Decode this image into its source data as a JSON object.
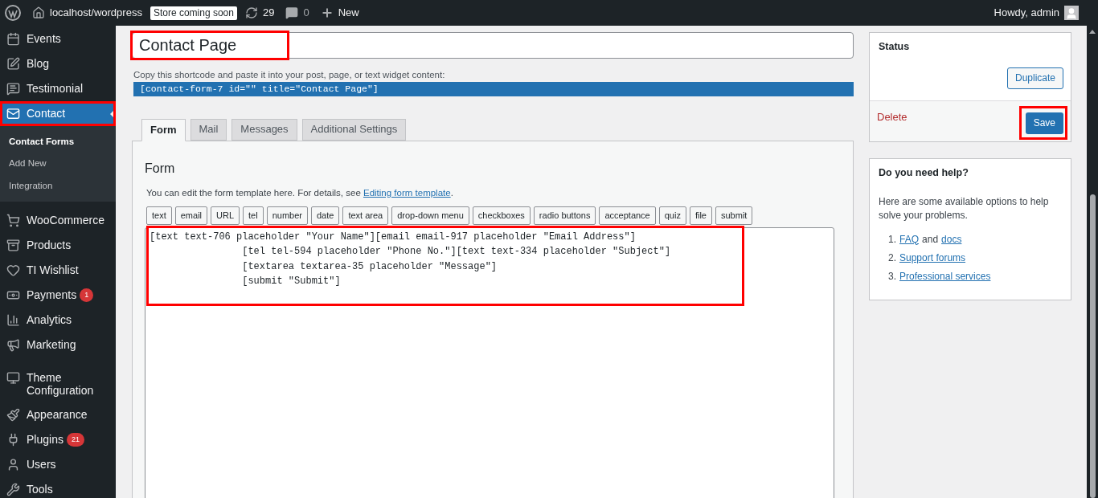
{
  "admin_bar": {
    "site": "localhost/wordpress",
    "store_badge": "Store coming soon",
    "updates": "29",
    "comments": "0",
    "new": "New",
    "greeting": "Howdy, admin"
  },
  "sidebar": {
    "items": [
      {
        "label": "Events",
        "selected": false,
        "highlighted": false
      },
      {
        "label": "Blog",
        "selected": false,
        "highlighted": false
      },
      {
        "label": "Testimonial",
        "selected": false,
        "highlighted": false
      },
      {
        "label": "Contact",
        "selected": true,
        "highlighted": true,
        "children": [
          {
            "label": "Contact Forms",
            "selected": true
          },
          {
            "label": "Add New",
            "selected": false
          },
          {
            "label": "Integration",
            "selected": false
          }
        ]
      },
      {
        "label": "WooCommerce",
        "selected": false,
        "highlighted": false
      },
      {
        "label": "Products",
        "selected": false,
        "highlighted": false
      },
      {
        "label": "TI Wishlist",
        "selected": false,
        "highlighted": false
      },
      {
        "label": "Payments",
        "selected": false,
        "highlighted": false,
        "badge": "1"
      },
      {
        "label": "Analytics",
        "selected": false,
        "highlighted": false
      },
      {
        "label": "Marketing",
        "selected": false,
        "highlighted": false
      },
      {
        "label": "Theme Configuration",
        "selected": false,
        "highlighted": false
      },
      {
        "label": "Appearance",
        "selected": false,
        "highlighted": false
      },
      {
        "label": "Plugins",
        "selected": false,
        "highlighted": false,
        "badge": "21"
      },
      {
        "label": "Users",
        "selected": false,
        "highlighted": false
      },
      {
        "label": "Tools",
        "selected": false,
        "highlighted": false
      }
    ]
  },
  "title_field": {
    "value": "Contact Page",
    "highlighted": true
  },
  "shortcode": {
    "hint": "Copy this shortcode and paste it into your post, page, or text widget content:",
    "code": "[contact-form-7 id=\"\" title=\"Contact Page\"]"
  },
  "tabs": [
    {
      "label": "Form",
      "selected": true
    },
    {
      "label": "Mail",
      "selected": false
    },
    {
      "label": "Messages",
      "selected": false
    },
    {
      "label": "Additional Settings",
      "selected": false
    }
  ],
  "form_panel": {
    "heading": "Form",
    "description_before": "You can edit the form template here. For details, see ",
    "link": "Editing form template",
    "description_after": ".",
    "tag_buttons": [
      "text",
      "email",
      "URL",
      "tel",
      "number",
      "date",
      "text area",
      "drop-down menu",
      "checkboxes",
      "radio buttons",
      "acceptance",
      "quiz",
      "file",
      "submit"
    ],
    "template": {
      "highlighted": true,
      "lines": [
        "[text text-706 placeholder \"Your Name\"][email email-917 placeholder \"Email Address\"]",
        "                [tel tel-594 placeholder \"Phone No.\"][text text-334 placeholder \"Subject\"]",
        "                [textarea textarea-35 placeholder \"Message\"]",
        "                [submit \"Submit\"]"
      ]
    }
  },
  "status_box": {
    "title": "Status",
    "duplicate": "Duplicate",
    "delete": "Delete",
    "save": "Save",
    "save_highlighted": true
  },
  "help_box": {
    "title": "Do you need help?",
    "text": "Here are some available options to help solve your problems.",
    "items": [
      {
        "number": "1.",
        "links": [
          "FAQ",
          "docs"
        ],
        "joiner": "and"
      },
      {
        "number": "2.",
        "links": [
          "Support forums"
        ]
      },
      {
        "number": "3.",
        "links": [
          "Professional services"
        ]
      }
    ]
  }
}
